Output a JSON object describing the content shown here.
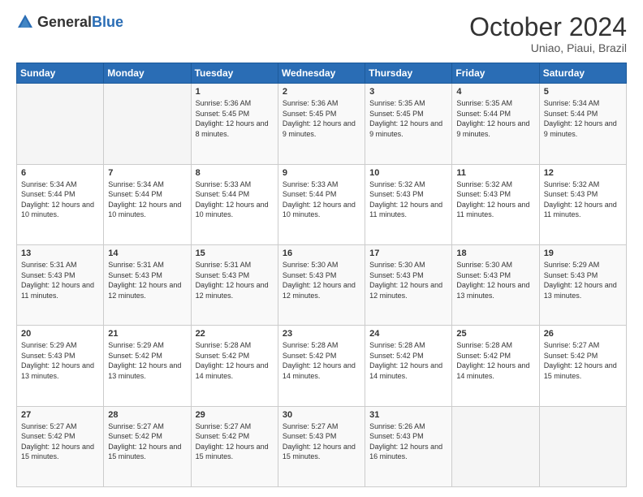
{
  "header": {
    "logo_general": "General",
    "logo_blue": "Blue",
    "month_title": "October 2024",
    "location": "Uniao, Piaui, Brazil"
  },
  "days_of_week": [
    "Sunday",
    "Monday",
    "Tuesday",
    "Wednesday",
    "Thursday",
    "Friday",
    "Saturday"
  ],
  "weeks": [
    [
      {
        "day": "",
        "info": ""
      },
      {
        "day": "",
        "info": ""
      },
      {
        "day": "1",
        "info": "Sunrise: 5:36 AM\nSunset: 5:45 PM\nDaylight: 12 hours and 8 minutes."
      },
      {
        "day": "2",
        "info": "Sunrise: 5:36 AM\nSunset: 5:45 PM\nDaylight: 12 hours and 9 minutes."
      },
      {
        "day": "3",
        "info": "Sunrise: 5:35 AM\nSunset: 5:45 PM\nDaylight: 12 hours and 9 minutes."
      },
      {
        "day": "4",
        "info": "Sunrise: 5:35 AM\nSunset: 5:44 PM\nDaylight: 12 hours and 9 minutes."
      },
      {
        "day": "5",
        "info": "Sunrise: 5:34 AM\nSunset: 5:44 PM\nDaylight: 12 hours and 9 minutes."
      }
    ],
    [
      {
        "day": "6",
        "info": "Sunrise: 5:34 AM\nSunset: 5:44 PM\nDaylight: 12 hours and 10 minutes."
      },
      {
        "day": "7",
        "info": "Sunrise: 5:34 AM\nSunset: 5:44 PM\nDaylight: 12 hours and 10 minutes."
      },
      {
        "day": "8",
        "info": "Sunrise: 5:33 AM\nSunset: 5:44 PM\nDaylight: 12 hours and 10 minutes."
      },
      {
        "day": "9",
        "info": "Sunrise: 5:33 AM\nSunset: 5:44 PM\nDaylight: 12 hours and 10 minutes."
      },
      {
        "day": "10",
        "info": "Sunrise: 5:32 AM\nSunset: 5:43 PM\nDaylight: 12 hours and 11 minutes."
      },
      {
        "day": "11",
        "info": "Sunrise: 5:32 AM\nSunset: 5:43 PM\nDaylight: 12 hours and 11 minutes."
      },
      {
        "day": "12",
        "info": "Sunrise: 5:32 AM\nSunset: 5:43 PM\nDaylight: 12 hours and 11 minutes."
      }
    ],
    [
      {
        "day": "13",
        "info": "Sunrise: 5:31 AM\nSunset: 5:43 PM\nDaylight: 12 hours and 11 minutes."
      },
      {
        "day": "14",
        "info": "Sunrise: 5:31 AM\nSunset: 5:43 PM\nDaylight: 12 hours and 12 minutes."
      },
      {
        "day": "15",
        "info": "Sunrise: 5:31 AM\nSunset: 5:43 PM\nDaylight: 12 hours and 12 minutes."
      },
      {
        "day": "16",
        "info": "Sunrise: 5:30 AM\nSunset: 5:43 PM\nDaylight: 12 hours and 12 minutes."
      },
      {
        "day": "17",
        "info": "Sunrise: 5:30 AM\nSunset: 5:43 PM\nDaylight: 12 hours and 12 minutes."
      },
      {
        "day": "18",
        "info": "Sunrise: 5:30 AM\nSunset: 5:43 PM\nDaylight: 12 hours and 13 minutes."
      },
      {
        "day": "19",
        "info": "Sunrise: 5:29 AM\nSunset: 5:43 PM\nDaylight: 12 hours and 13 minutes."
      }
    ],
    [
      {
        "day": "20",
        "info": "Sunrise: 5:29 AM\nSunset: 5:43 PM\nDaylight: 12 hours and 13 minutes."
      },
      {
        "day": "21",
        "info": "Sunrise: 5:29 AM\nSunset: 5:42 PM\nDaylight: 12 hours and 13 minutes."
      },
      {
        "day": "22",
        "info": "Sunrise: 5:28 AM\nSunset: 5:42 PM\nDaylight: 12 hours and 14 minutes."
      },
      {
        "day": "23",
        "info": "Sunrise: 5:28 AM\nSunset: 5:42 PM\nDaylight: 12 hours and 14 minutes."
      },
      {
        "day": "24",
        "info": "Sunrise: 5:28 AM\nSunset: 5:42 PM\nDaylight: 12 hours and 14 minutes."
      },
      {
        "day": "25",
        "info": "Sunrise: 5:28 AM\nSunset: 5:42 PM\nDaylight: 12 hours and 14 minutes."
      },
      {
        "day": "26",
        "info": "Sunrise: 5:27 AM\nSunset: 5:42 PM\nDaylight: 12 hours and 15 minutes."
      }
    ],
    [
      {
        "day": "27",
        "info": "Sunrise: 5:27 AM\nSunset: 5:42 PM\nDaylight: 12 hours and 15 minutes."
      },
      {
        "day": "28",
        "info": "Sunrise: 5:27 AM\nSunset: 5:42 PM\nDaylight: 12 hours and 15 minutes."
      },
      {
        "day": "29",
        "info": "Sunrise: 5:27 AM\nSunset: 5:42 PM\nDaylight: 12 hours and 15 minutes."
      },
      {
        "day": "30",
        "info": "Sunrise: 5:27 AM\nSunset: 5:43 PM\nDaylight: 12 hours and 15 minutes."
      },
      {
        "day": "31",
        "info": "Sunrise: 5:26 AM\nSunset: 5:43 PM\nDaylight: 12 hours and 16 minutes."
      },
      {
        "day": "",
        "info": ""
      },
      {
        "day": "",
        "info": ""
      }
    ]
  ]
}
